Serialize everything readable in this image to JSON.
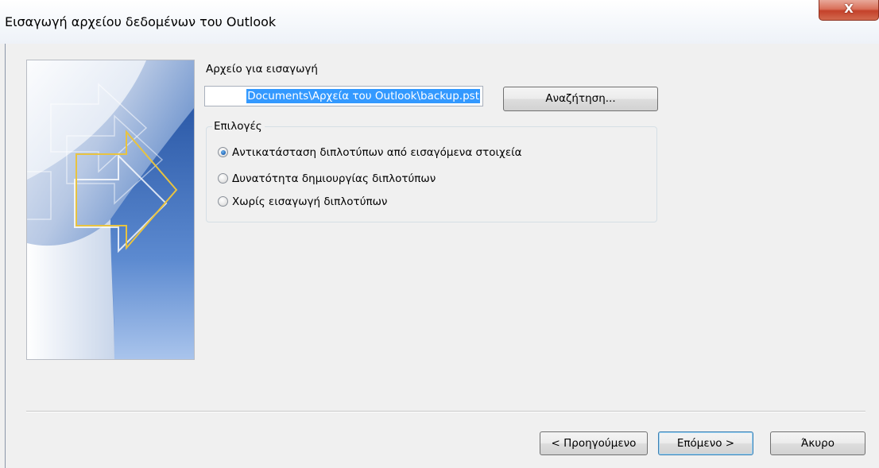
{
  "window": {
    "title": "Εισαγωγή αρχείου δεδομένων του Outlook",
    "close_label": "X"
  },
  "file": {
    "label": "Αρχείο για εισαγωγή",
    "value": "Documents\\Αρχεία του Outlook\\backup.pst",
    "browse_label": "Αναζήτηση..."
  },
  "options": {
    "legend": "Επιλογές",
    "items": [
      {
        "label": "Αντικατάσταση διπλοτύπων από εισαγόμενα στοιχεία",
        "checked": true
      },
      {
        "label": "Δυνατότητα δημιουργίας διπλοτύπων",
        "checked": false
      },
      {
        "label": "Χωρίς εισαγωγή διπλοτύπων",
        "checked": false
      }
    ]
  },
  "footer": {
    "back_label": "< Προηγούμενο",
    "next_label": "Επόμενο >",
    "cancel_label": "Άκυρο"
  },
  "colors": {
    "banner_blue": "#2f5fae",
    "arrow_yellow": "#e8c340",
    "selection": "#3399ff",
    "close_red": "#c4412a"
  },
  "icons": {
    "banner": "outlook-import-arrows-graphic",
    "close": "close-icon"
  }
}
